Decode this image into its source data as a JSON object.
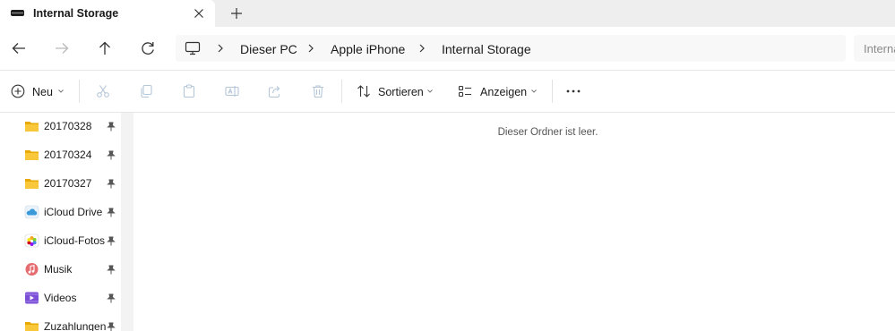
{
  "tab": {
    "title": "Internal Storage",
    "icon": "drive-icon",
    "close_icon": "close-icon",
    "new_tab_icon": "plus-icon"
  },
  "nav": {
    "back_icon": "arrow-left-icon",
    "forward_icon": "arrow-right-icon",
    "up_icon": "arrow-up-icon",
    "refresh_icon": "refresh-icon"
  },
  "address": {
    "root_icon": "computer-icon",
    "breadcrumbs": [
      "Dieser PC",
      "Apple iPhone",
      "Internal Storage"
    ]
  },
  "search": {
    "placeholder": "Internal Storage durchsuchen"
  },
  "commands": {
    "new_label": "Neu",
    "sort_label": "Sortieren",
    "view_label": "Anzeigen",
    "icons": [
      "cut-icon",
      "copy-icon",
      "paste-icon",
      "rename-icon",
      "share-icon",
      "delete-icon"
    ],
    "more_icon": "more-icon"
  },
  "sidebar": {
    "items": [
      {
        "label": "20170328",
        "icon": "folder-icon",
        "pinned": true
      },
      {
        "label": "20170324",
        "icon": "folder-icon",
        "pinned": true
      },
      {
        "label": "20170327",
        "icon": "folder-icon",
        "pinned": true
      },
      {
        "label": "iCloud Drive",
        "icon": "icloud-icon",
        "pinned": true
      },
      {
        "label": "iCloud-Fotos",
        "icon": "photos-icon",
        "pinned": true
      },
      {
        "label": "Musik",
        "icon": "music-icon",
        "pinned": true
      },
      {
        "label": "Videos",
        "icon": "video-icon",
        "pinned": true
      },
      {
        "label": "Zuzahlungen",
        "icon": "folder-icon",
        "pinned": true
      }
    ]
  },
  "content": {
    "empty_message": "Dieser Ordner ist leer."
  },
  "colors": {
    "tab_strip": "#eeeeee",
    "folder": "#f8c73a",
    "accent": "#0067c0",
    "disabled_icon": "#b4c6d8"
  }
}
